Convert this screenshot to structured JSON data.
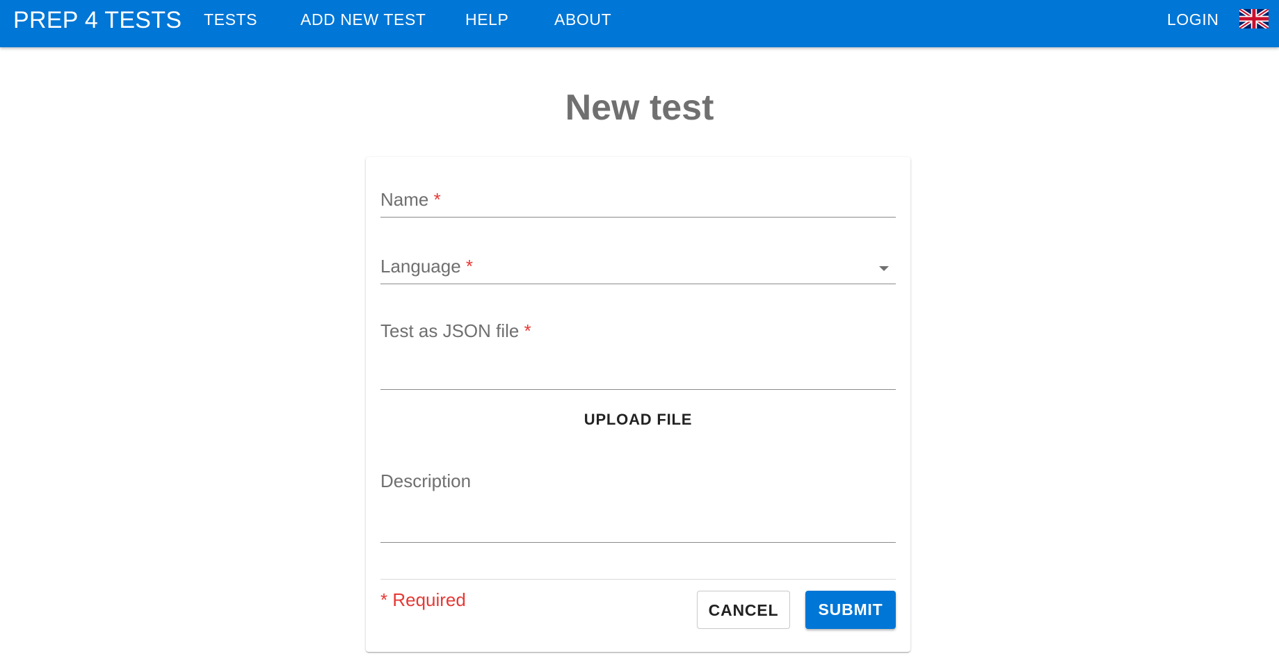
{
  "header": {
    "brand": "PREP 4 TESTS",
    "nav": {
      "tests": "TESTS",
      "add_new_test": "ADD NEW TEST",
      "help": "HELP",
      "about": "ABOUT"
    },
    "login": "LOGIN",
    "language_flag_icon": "uk-flag-icon"
  },
  "page": {
    "title": "New test"
  },
  "form": {
    "name_label": "Name",
    "language_label": "Language",
    "json_file_label": "Test as JSON file",
    "upload_label": "UPLOAD FILE",
    "description_label": "Description",
    "required_marker": "*",
    "required_note": "* Required",
    "cancel_label": "CANCEL",
    "submit_label": "SUBMIT"
  },
  "colors": {
    "primary": "#0076d6",
    "required": "#e53935",
    "title": "#707070"
  }
}
